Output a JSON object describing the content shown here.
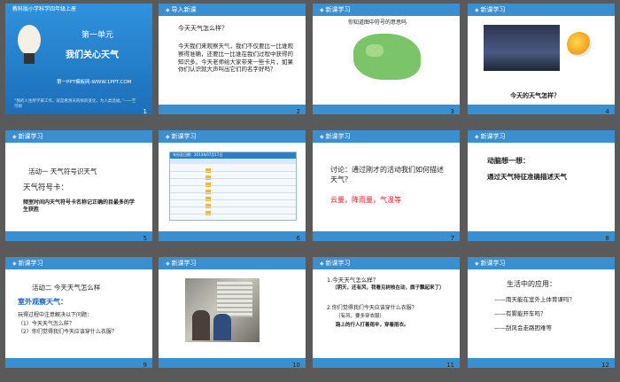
{
  "slides": [
    {
      "no": "1",
      "top": "教科版小学科学四年级上册",
      "unit": "第一单元",
      "title": "我们关心天气",
      "site": "第一PPT模板网-WWW.1PPT.COM",
      "quote": "“我的人生所学来工作，就是看清天的样的变化，为人类造福。”——竺可桢"
    },
    {
      "no": "2",
      "tag": "导入新课",
      "q": "今天天气怎么样？",
      "body": "今天我们来观察天气，我们不仅要比一比谁观察得准确，还要比一比谁在我们过程中获得的知识多。今天老师给大家带来一些卡片，如果你们认识就大声叫出它们的名字好吗？"
    },
    {
      "no": "3",
      "tag": "新课学习",
      "cap": "你知道图中符号的意思吗"
    },
    {
      "no": "4",
      "tag": "新课学习",
      "q": "今天的天气怎样？"
    },
    {
      "no": "5",
      "tag": "新课学习",
      "a": "活动一 天气符号识天气",
      "b": "天气符号卡：",
      "c": "频室时间内天气符号卡名称记正确的目最多的学生获胜"
    },
    {
      "no": "6",
      "tag": "新课学习",
      "header": "年份及日期：2013年07月17日"
    },
    {
      "no": "7",
      "tag": "新课学习",
      "q": "讨论：通过刚才的活动我们如何描述天气？",
      "ans": "云量，降雨量，气温等"
    },
    {
      "no": "8",
      "tag": "新课学习",
      "a": "动脑想一想：",
      "b": "通过天气特征准确描述天气"
    },
    {
      "no": "9",
      "tag": "新课学习",
      "a": "活动二 今天天气怎么样",
      "b": "室外观察天气：",
      "c": "玩得过程中注意解决以下问题：",
      "d": "（1）今天天气怎么样？",
      "e": "（2）你们觉得我们今天应该穿什么衣服？"
    },
    {
      "no": "10",
      "tag": "新课学习"
    },
    {
      "no": "11",
      "tag": "新课学习",
      "a": "1.今天天气怎么样？",
      "b": "（阴天，还有风，我看见树枝在动，旗子飘起来了）",
      "c": "2.你们觉得我们今天应该穿什么衣服？",
      "d": "（有风，要多穿衣服）",
      "e": "路上的行人打着雨伞，穿着雨衣。"
    },
    {
      "no": "12",
      "tag": "新课学习",
      "a": "生活中的应用：",
      "b": "——雨天能在室外上体育课吗？",
      "c": "——有雾能开车吗？",
      "d": "——刮风会走路困难等"
    }
  ]
}
